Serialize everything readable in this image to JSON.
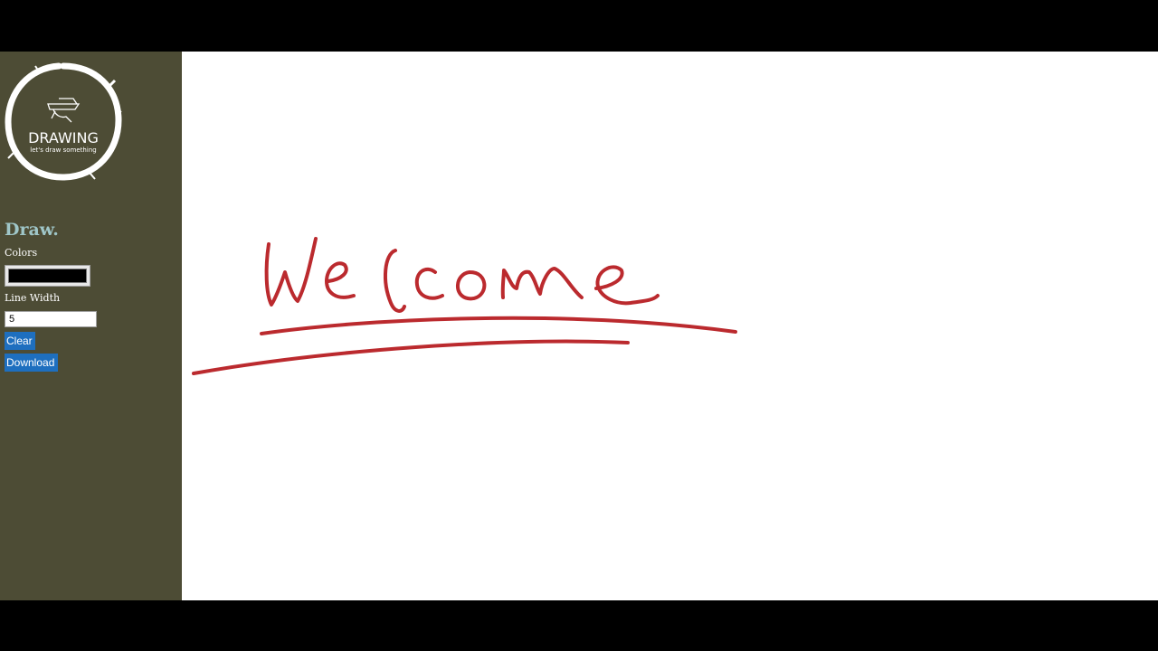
{
  "logo": {
    "title": "DRAWING",
    "tagline": "let's draw something"
  },
  "sidebar": {
    "brand": "Draw.",
    "colors_label": "Colors",
    "color_value": "#000000",
    "line_width_label": "Line Width",
    "line_width_value": "5",
    "clear_label": "Clear",
    "download_label": "Download"
  },
  "canvas": {
    "stroke_color": "#bb2a2e",
    "content": "Welcome"
  },
  "colors": {
    "sidebar_bg": "#4d4c35",
    "button_bg": "#1e6fbf",
    "brand_text": "#9fc6c8"
  }
}
